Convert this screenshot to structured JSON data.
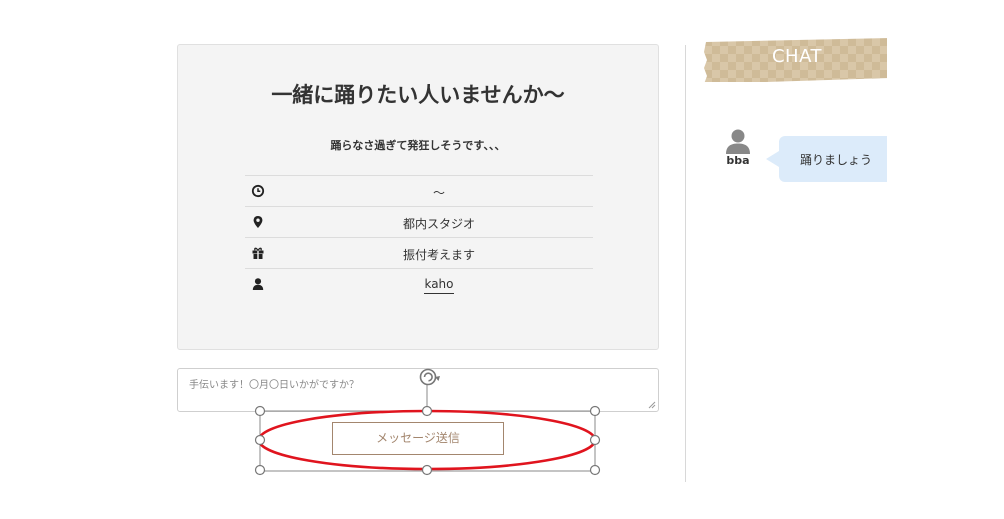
{
  "event": {
    "title": "一緒に踊りたい人いませんか〜",
    "subtitle": "踊らなさ過ぎて発狂しそうです、、、",
    "details": [
      {
        "icon": "clock-icon",
        "value": "〜"
      },
      {
        "icon": "map-pin-icon",
        "value": "都内スタジオ"
      },
      {
        "icon": "gift-icon",
        "value": "振付考えます"
      },
      {
        "icon": "user-icon",
        "value": "kaho"
      }
    ]
  },
  "message": {
    "placeholder": "手伝います！〇月〇日いかがですか？",
    "send_label": "メッセージ送信"
  },
  "chat": {
    "header": "CHAT",
    "messages": [
      {
        "user": "bba",
        "text": "踊りましょう"
      }
    ]
  },
  "colors": {
    "accent": "#a3866e",
    "card_bg": "#f4f4f4",
    "bubble_bg": "#dcebfa",
    "ribbon": "#d9c6a8",
    "annotation": "#e0141e"
  }
}
